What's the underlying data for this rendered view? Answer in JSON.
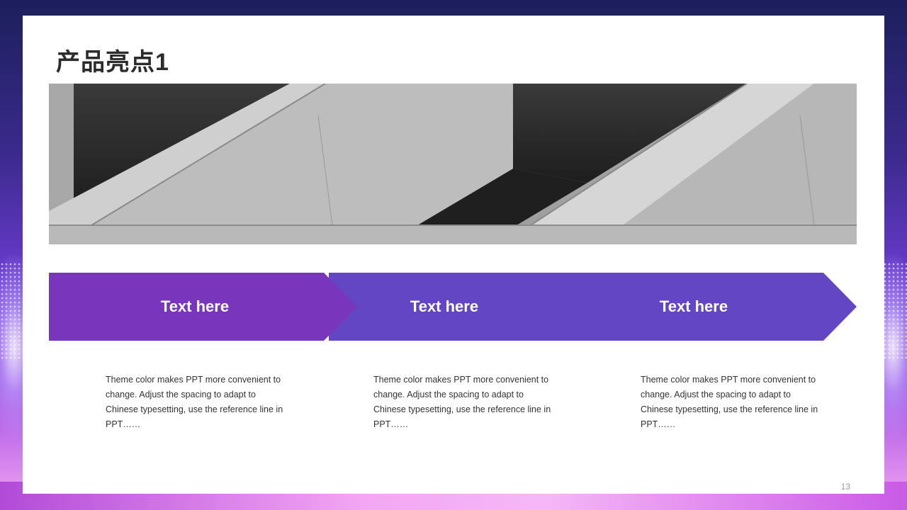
{
  "slide": {
    "title": "产品亮点1",
    "page_number": "13"
  },
  "steps": [
    {
      "label": "Text here",
      "description": "Theme color makes PPT more convenient to change. Adjust the spacing to adapt to Chinese typesetting, use the reference line in PPT……"
    },
    {
      "label": "Text here",
      "description": "Theme color makes PPT more convenient to change. Adjust the spacing to adapt to Chinese typesetting, use the reference line in PPT……"
    },
    {
      "label": "Text here",
      "description": "Theme color makes PPT more convenient to change. Adjust the spacing to adapt to Chinese typesetting, use the reference line in PPT……"
    }
  ],
  "colors": {
    "arrow_left": "#7a35bd",
    "arrow_right": "#6246c3",
    "text_dark": "#2b2b2b",
    "body_text": "#333333",
    "background_top": "#1c1f5c",
    "background_bottom": "#f3a8f2"
  },
  "image": {
    "subject": "grayscale concrete architecture diagonal beams"
  }
}
